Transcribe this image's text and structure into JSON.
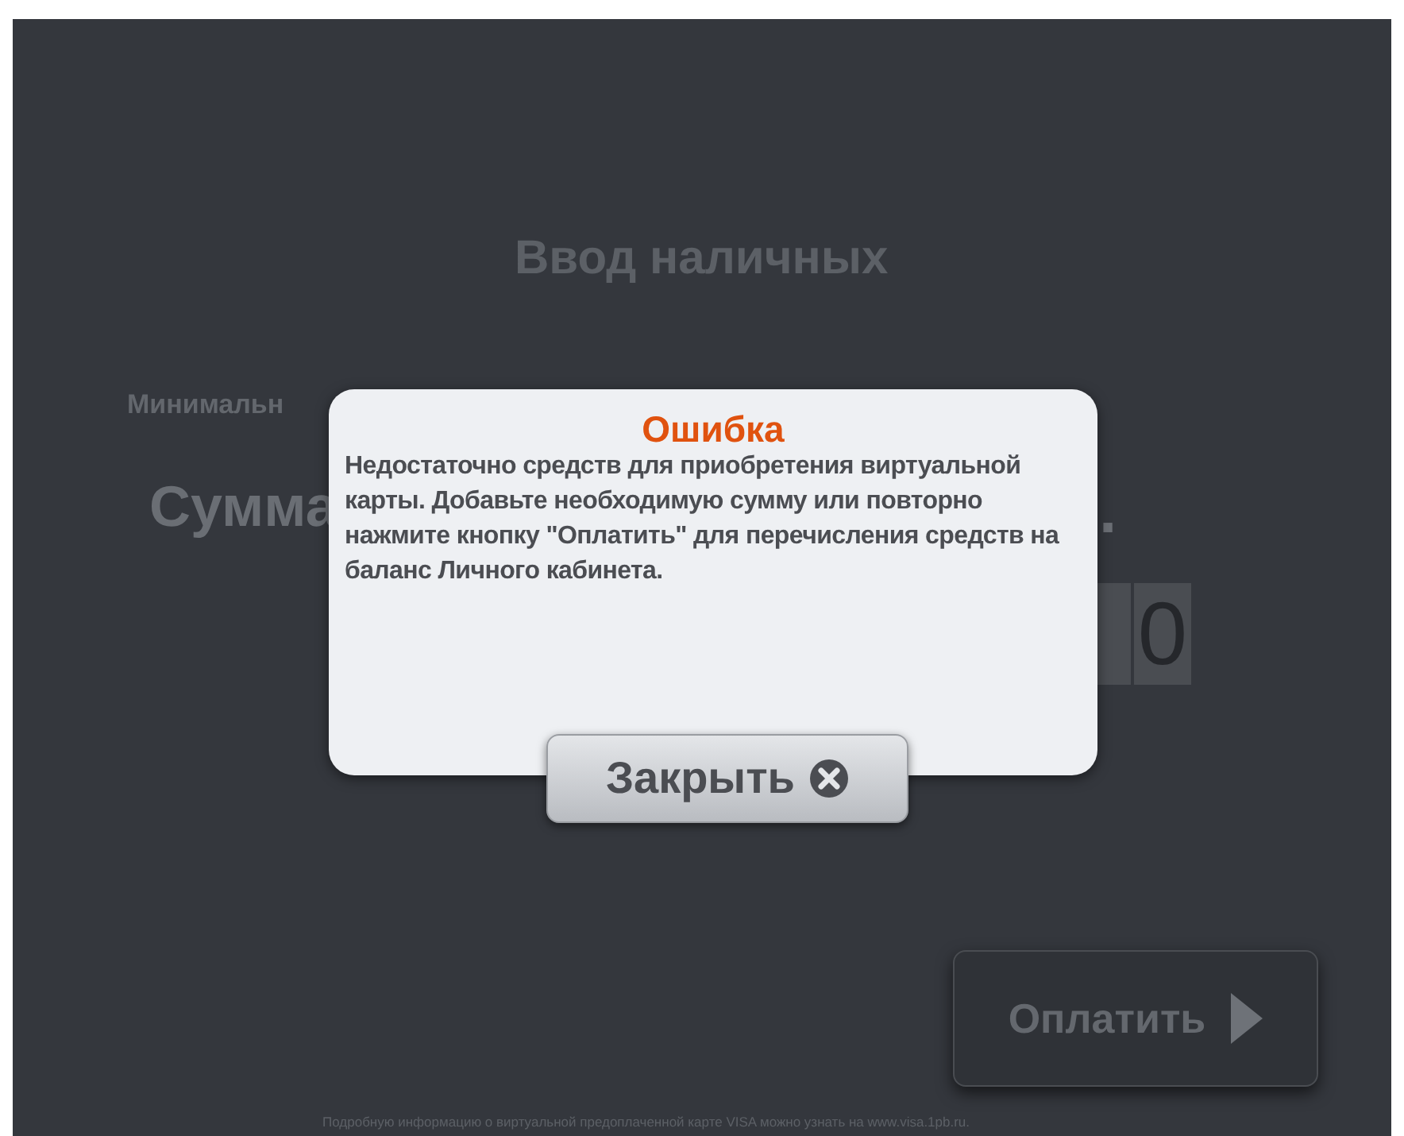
{
  "screen": {
    "title": "Ввод наличных",
    "min_label": "Минимальн",
    "sum_label": "Сумма",
    "sum_dot": ".",
    "digits": [
      "0"
    ],
    "pay_button": "Оплатить",
    "footer": "Подробную информацию о виртуальной предоплаченной карте VISA можно узнать на www.visa.1pb.ru."
  },
  "dialog": {
    "title": "Ошибка",
    "message": "Недостаточно средств для приобретения виртуальной карты. Добавьте необходимую сумму или повторно нажмите кнопку \"Оплатить\" для перечисления средств на баланс Личного кабинета.",
    "close_button": "Закрыть"
  }
}
